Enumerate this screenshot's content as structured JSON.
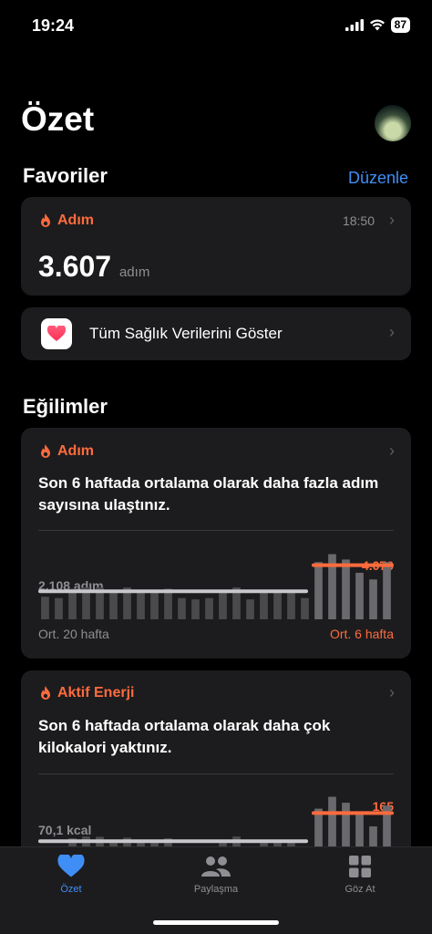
{
  "status": {
    "time": "19:24",
    "battery": "87"
  },
  "header": {
    "title": "Özet"
  },
  "favorites": {
    "title": "Favoriler",
    "edit_label": "Düzenle",
    "step_card": {
      "label": "Adım",
      "time": "18:50",
      "value": "3.607",
      "unit": "adım"
    },
    "all_data_label": "Tüm Sağlık Verilerini Göster"
  },
  "trends": {
    "title": "Eğilimler",
    "steps": {
      "label": "Adım",
      "text": "Son 6 haftada ortalama olarak daha fazla adım sayısına ulaştınız.",
      "old_value": "2.108 adım",
      "new_value": "4.070",
      "avg_left": "Ort. 20 hafta",
      "avg_right": "Ort. 6 hafta"
    },
    "energy": {
      "label": "Aktif Enerji",
      "text": "Son 6 haftada ortalama olarak daha çok kilokalori yaktınız.",
      "old_value": "70,1 kcal",
      "new_value": "165"
    }
  },
  "tabs": {
    "summary": "Özet",
    "sharing": "Paylaşma",
    "browse": "Göz At"
  },
  "colors": {
    "accent": "#3f8ef5",
    "orange": "#ff6b3d",
    "card": "#1c1c1e"
  },
  "chart_data": [
    {
      "type": "bar",
      "title": "",
      "categories": [],
      "series": [
        {
          "values": [
            1700,
            1600,
            2300,
            2400,
            2400,
            2100,
            2400,
            2200,
            2100,
            2300,
            1600,
            1500,
            1600,
            2100,
            2400,
            1500,
            2100,
            2000,
            2100,
            1600,
            4300,
            4900,
            4500,
            3500,
            3000,
            4300
          ]
        }
      ],
      "avg_old": 2108,
      "avg_new": 4070
    },
    {
      "type": "bar",
      "title": "",
      "categories": [],
      "series": [
        {
          "values": [
            45,
            48,
            80,
            86,
            85,
            70,
            82,
            75,
            72,
            80,
            48,
            42,
            50,
            73,
            86,
            45,
            72,
            68,
            70,
            50,
            180,
            220,
            200,
            160,
            120,
            190
          ]
        }
      ],
      "avg_old": 70.1,
      "avg_new": 165
    }
  ]
}
